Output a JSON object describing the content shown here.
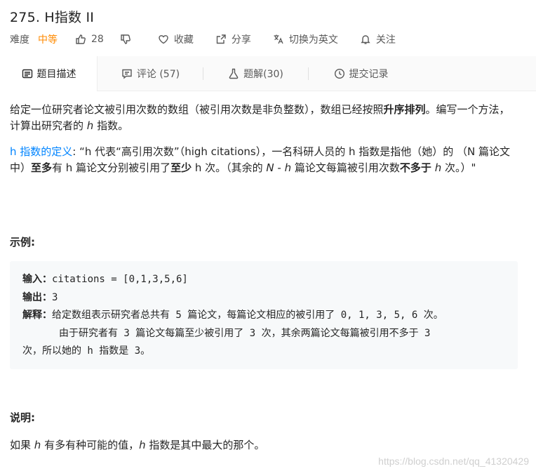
{
  "problem": {
    "title": "275. H指数 II",
    "difficulty_label": "难度",
    "difficulty": "中等",
    "likes": "28",
    "favorite_label": "收藏",
    "share_label": "分享",
    "language_toggle_label": "切换为英文",
    "follow_label": "关注"
  },
  "tabs": [
    {
      "label": "题目描述",
      "icon": "description-icon"
    },
    {
      "label": "评论 (57)",
      "icon": "comment-icon"
    },
    {
      "label": "题解(30)",
      "icon": "flask-icon"
    },
    {
      "label": "提交记录",
      "icon": "clock-icon"
    }
  ],
  "description": {
    "p1_a": "给定一位研究者论文被引用次数的数组（被引用次数是非负整数），数组已经按照",
    "p1_bold": "升序排列",
    "p1_b": "。编写一个方法，计算出研究者的",
    "p1_var": "h",
    "p1_c": "指数。",
    "p2_link": "h 指数的定义",
    "p2_a": ": “h 代表“高引用次数”（high citations），一名科研人员的 h 指数是指他（她）的 （N 篇论文中）",
    "p2_bold1": "至多",
    "p2_b": "有 h 篇论文分别被引用了",
    "p2_bold2": "至少",
    "p2_c": " h 次。（其余的",
    "p2_var_n": "N",
    "p2_dash": " - ",
    "p2_var_h": "h",
    "p2_d": "篇论文每篇被引用次数",
    "p2_bold3": "不多于",
    "p2_var_h2": "h",
    "p2_e": "次。）\""
  },
  "example": {
    "section_title": "示例:",
    "input_label": "输入",
    "input_value": "citations = [0,1,3,5,6]",
    "output_label": "输出",
    "output_value": "3",
    "explain_label": "解释",
    "explain_line1": "给定数组表示研究者总共有 5 篇论文，每篇论文相应的被引用了 0, 1, 3, 5, 6 次。",
    "explain_line2": "由于研究者有 3 篇论文每篇至少被引用了 3 次，其余两篇论文每篇被引用不多于 3",
    "explain_line3": "次，所以她的 h 指数是 3。"
  },
  "notes": {
    "section_title": "说明:",
    "line_a": "如果",
    "line_var": "h",
    "line_b": "有多有种可能的值，",
    "line_var2": "h",
    "line_c": "指数是其中最大的那个。"
  },
  "watermark": "https://blog.csdn.net/qq_41320429",
  "colors": {
    "accent_orange": "#ff8a00",
    "link_blue": "#0084ff",
    "code_bg": "#f7f9fa"
  }
}
